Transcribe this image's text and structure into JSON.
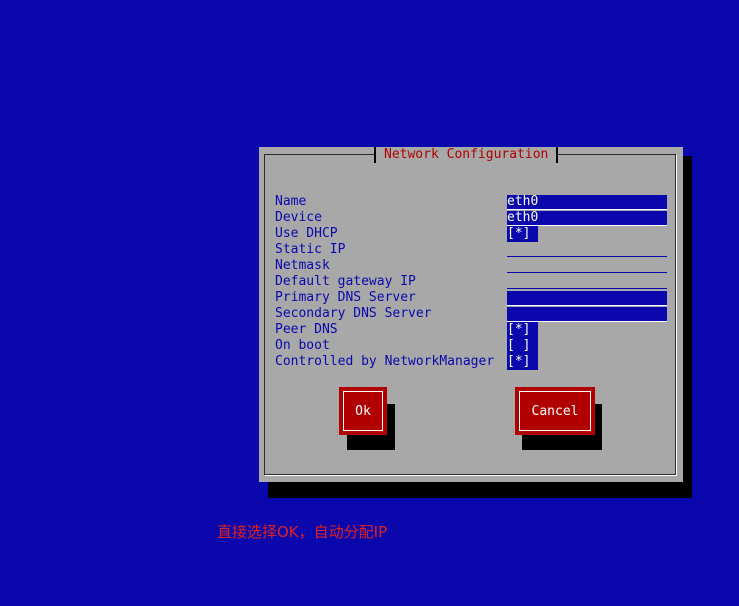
{
  "dialog": {
    "title": "Network Configuration",
    "fields": {
      "name": {
        "label": "Name",
        "value": "eth0"
      },
      "device": {
        "label": "Device",
        "value": "eth0"
      },
      "use_dhcp": {
        "label": "Use DHCP",
        "value": "[*]"
      },
      "static_ip": {
        "label": "Static IP",
        "value": ""
      },
      "netmask": {
        "label": "Netmask",
        "value": ""
      },
      "default_gateway": {
        "label": "Default gateway IP",
        "value": ""
      },
      "primary_dns": {
        "label": "Primary DNS Server",
        "value": ""
      },
      "secondary_dns": {
        "label": "Secondary DNS Server",
        "value": ""
      },
      "peer_dns": {
        "label": "Peer DNS",
        "value": "[*]"
      },
      "on_boot": {
        "label": "On boot",
        "value": "[ ]"
      },
      "nm_controlled": {
        "label": "Controlled by NetworkManager",
        "value": "[*]"
      }
    },
    "buttons": {
      "ok": "Ok",
      "cancel": "Cancel"
    }
  },
  "caption": "直接选择OK，自动分配IP",
  "colors": {
    "background": "#0a08ad",
    "dialog": "#a8a8a8",
    "title_text": "#b00000",
    "button": "#b00000",
    "caption": "#e02020"
  }
}
